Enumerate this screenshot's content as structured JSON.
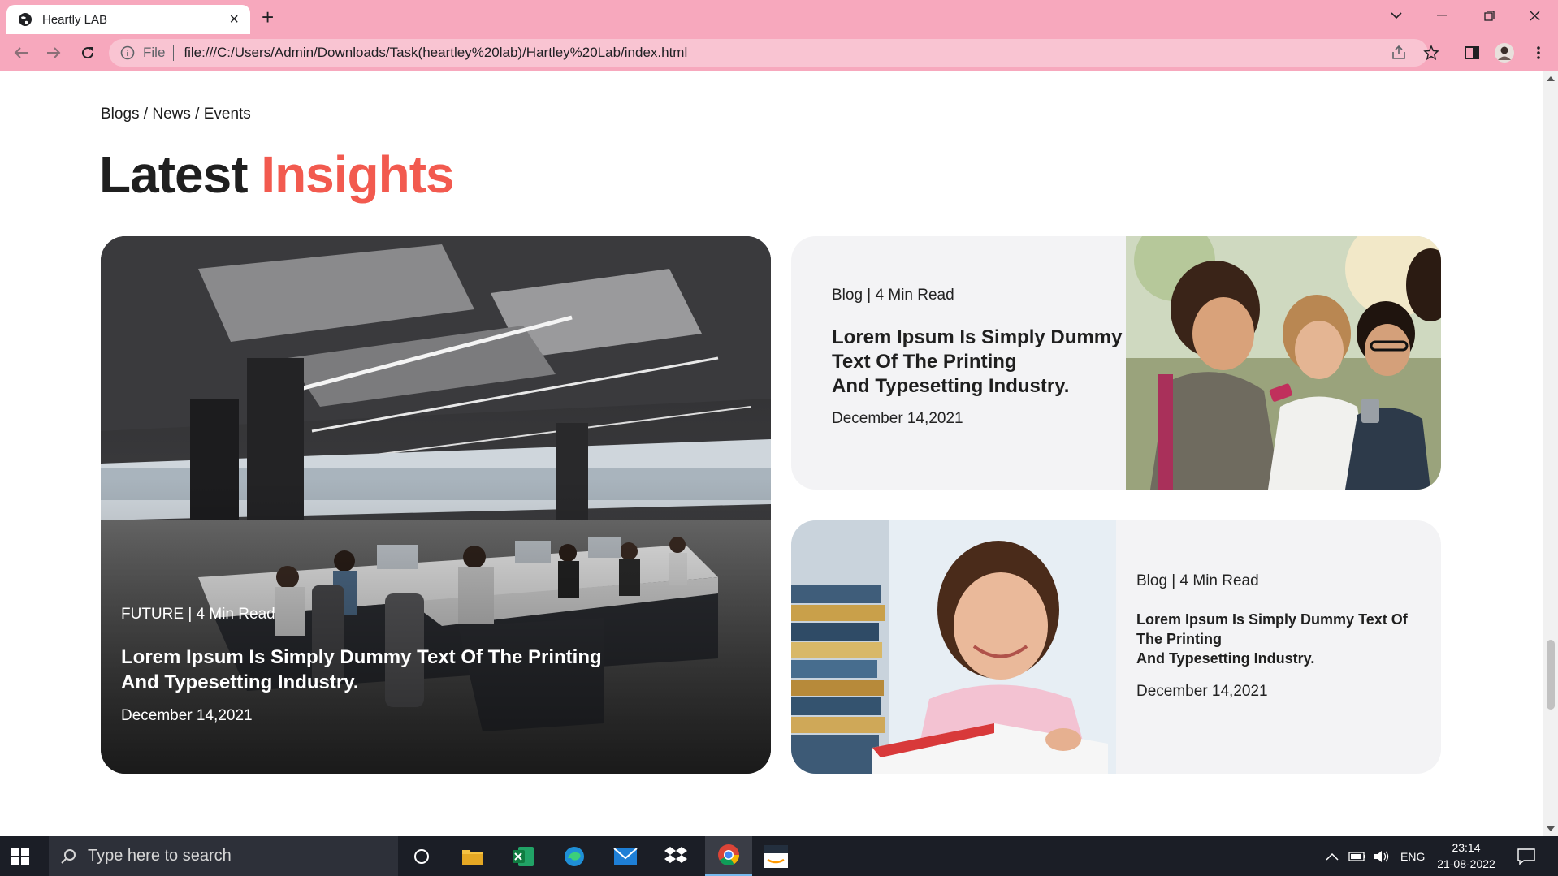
{
  "browser": {
    "tab_title": "Heartly LAB",
    "url_scheme": "File",
    "url": "file:///C:/Users/Admin/Downloads/Task(heartley%20lab)/Hartley%20Lab/index.html"
  },
  "page": {
    "breadcrumb": "Blogs / News / Events",
    "heading_main": "Latest",
    "heading_accent": "Insights",
    "accent_color": "#f25a4f"
  },
  "hero_card": {
    "meta": "FUTURE | 4 Min Read",
    "title": "Lorem Ipsum Is Simply Dummy Text Of The Printing And Typesetting Industry.",
    "date": "December 14,2021"
  },
  "side_cards": [
    {
      "meta": "Blog | 4 Min Read",
      "title_lines": [
        "Lorem Ipsum Is Simply Dummy",
        "Text Of The Printing",
        "And Typesetting Industry."
      ],
      "date": "December 14,2021"
    },
    {
      "meta": "Blog | 4 Min Read",
      "title_lines": [
        "Lorem Ipsum Is Simply Dummy Text Of",
        "The Printing",
        "And Typesetting Industry."
      ],
      "date": "December 14,2021"
    }
  ],
  "taskbar": {
    "search_placeholder": "Type here to search",
    "language": "ENG",
    "time": "23:14",
    "date": "21-08-2022"
  }
}
